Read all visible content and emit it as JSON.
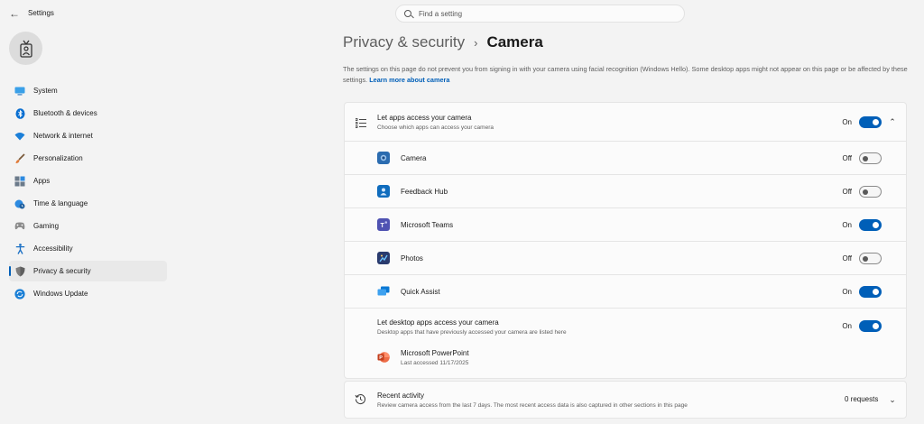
{
  "window": {
    "title": "Settings"
  },
  "search": {
    "placeholder": "Find a setting"
  },
  "sidebar": {
    "items": [
      {
        "label": "System",
        "icon": "monitor-icon",
        "color": "#0078d4"
      },
      {
        "label": "Bluetooth & devices",
        "icon": "bluetooth-icon",
        "color": "#0078d4"
      },
      {
        "label": "Network & internet",
        "icon": "wifi-icon",
        "color": "#0078d4"
      },
      {
        "label": "Personalization",
        "icon": "brush-icon",
        "color": "#e07b39"
      },
      {
        "label": "Apps",
        "icon": "apps-grid-icon",
        "color": "#5c6b7a"
      },
      {
        "label": "Time & language",
        "icon": "clock-globe-icon",
        "color": "#0078d4"
      },
      {
        "label": "Gaming",
        "icon": "gamepad-icon",
        "color": "#8a8a8a"
      },
      {
        "label": "Accessibility",
        "icon": "accessibility-person-icon",
        "color": "#0078d4"
      },
      {
        "label": "Privacy & security",
        "icon": "shield-icon",
        "color": "#6b6b6b",
        "selected": true
      },
      {
        "label": "Windows Update",
        "icon": "update-arrows-icon",
        "color": "#0078d4"
      }
    ]
  },
  "breadcrumb": {
    "parent": "Privacy & security",
    "separator": "›",
    "current": "Camera"
  },
  "description": {
    "text": "The settings on this page do not prevent you from signing in with your camera using facial recognition (Windows Hello). Some desktop apps might not appear on this page or be affected by these settings.",
    "link": "Learn more about camera"
  },
  "apps_access": {
    "title": "Let apps access your camera",
    "subtitle": "Choose which apps can access your camera",
    "state": "On",
    "apps": [
      {
        "name": "Camera",
        "state": "Off",
        "on": false,
        "icon": "camera-app-icon",
        "color": "#2b6cb0"
      },
      {
        "name": "Feedback Hub",
        "state": "Off",
        "on": false,
        "icon": "feedback-hub-icon",
        "color": "#0f6cbd"
      },
      {
        "name": "Microsoft Teams",
        "state": "On",
        "on": true,
        "icon": "teams-icon",
        "color": "#4f52b2"
      },
      {
        "name": "Photos",
        "state": "Off",
        "on": false,
        "icon": "photos-icon",
        "color": "#2a3b6e"
      },
      {
        "name": "Quick Assist",
        "state": "On",
        "on": true,
        "icon": "quick-assist-icon",
        "color": "#0a78d4"
      }
    ]
  },
  "desktop_access": {
    "title": "Let desktop apps access your camera",
    "subtitle": "Desktop apps that have previously accessed your camera are listed here",
    "state": "On",
    "apps": [
      {
        "name": "Microsoft PowerPoint",
        "last_accessed": "Last accessed 11/17/2025",
        "icon": "powerpoint-icon",
        "color": "#c43e1c"
      }
    ]
  },
  "recent_activity": {
    "title": "Recent activity",
    "subtitle": "Review camera access from the last 7 days. The most recent access data is also captured in other sections in this page",
    "count": "0 requests"
  },
  "colors": {
    "accent": "#005fb8",
    "background": "#f3f3f3",
    "card": "#fbfbfb"
  }
}
